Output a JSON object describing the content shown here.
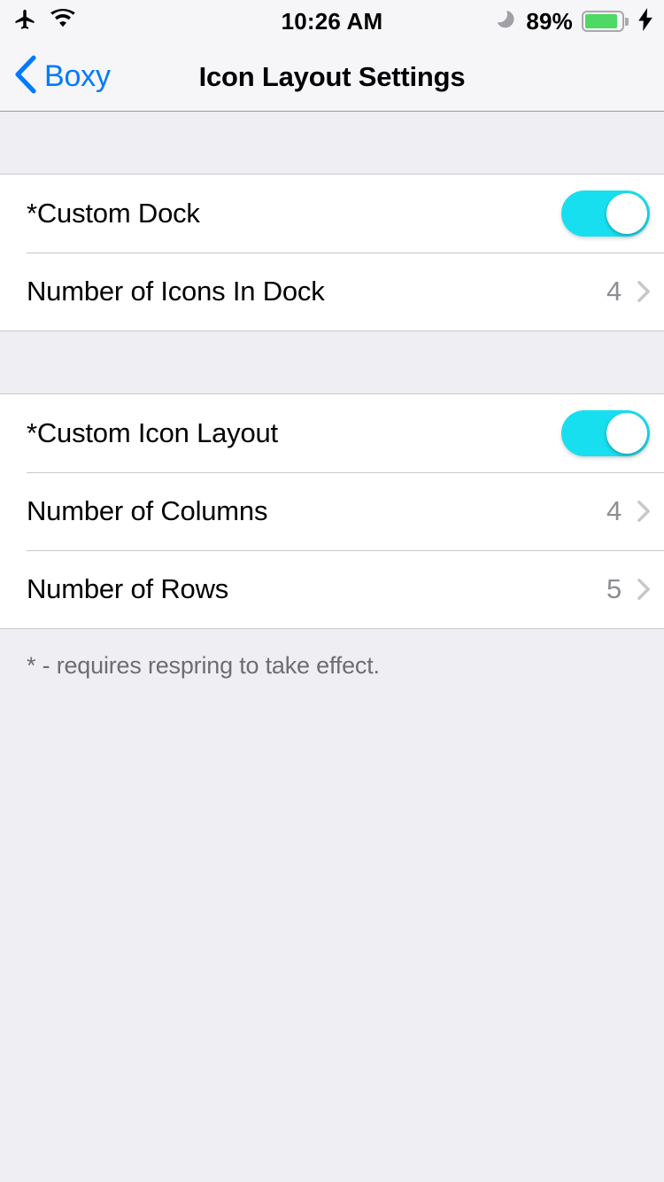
{
  "status_bar": {
    "airplane_icon": "airplane-icon",
    "wifi_icon": "wifi-icon",
    "time": "10:26 AM",
    "dnd_icon": "moon-icon",
    "battery_percent": "89%",
    "battery_level": 89,
    "battery_color": "#4CD964",
    "charging_icon": "lightning-bolt-icon"
  },
  "nav_bar": {
    "back_label": "Boxy",
    "back_icon": "chevron-left-icon",
    "title": "Icon Layout Settings",
    "tint_color": "#007AFF"
  },
  "sections": [
    {
      "rows": [
        {
          "label": "*Custom Dock",
          "type": "switch",
          "value": "on"
        },
        {
          "label": "Number of Icons In Dock",
          "type": "disclosure",
          "value": "4"
        }
      ]
    },
    {
      "rows": [
        {
          "label": "*Custom Icon Layout",
          "type": "switch",
          "value": "on"
        },
        {
          "label": "Number of Columns",
          "type": "disclosure",
          "value": "4"
        },
        {
          "label": "Number of Rows",
          "type": "disclosure",
          "value": "5"
        }
      ]
    }
  ],
  "footer": {
    "note": "* - requires respring to take effect."
  },
  "colors": {
    "switch_on": "#18DFF0",
    "background": "#EFEEF3",
    "cell": "#FFFFFF",
    "separator": "#C8C7CC",
    "secondary_text": "#8E8E93"
  }
}
